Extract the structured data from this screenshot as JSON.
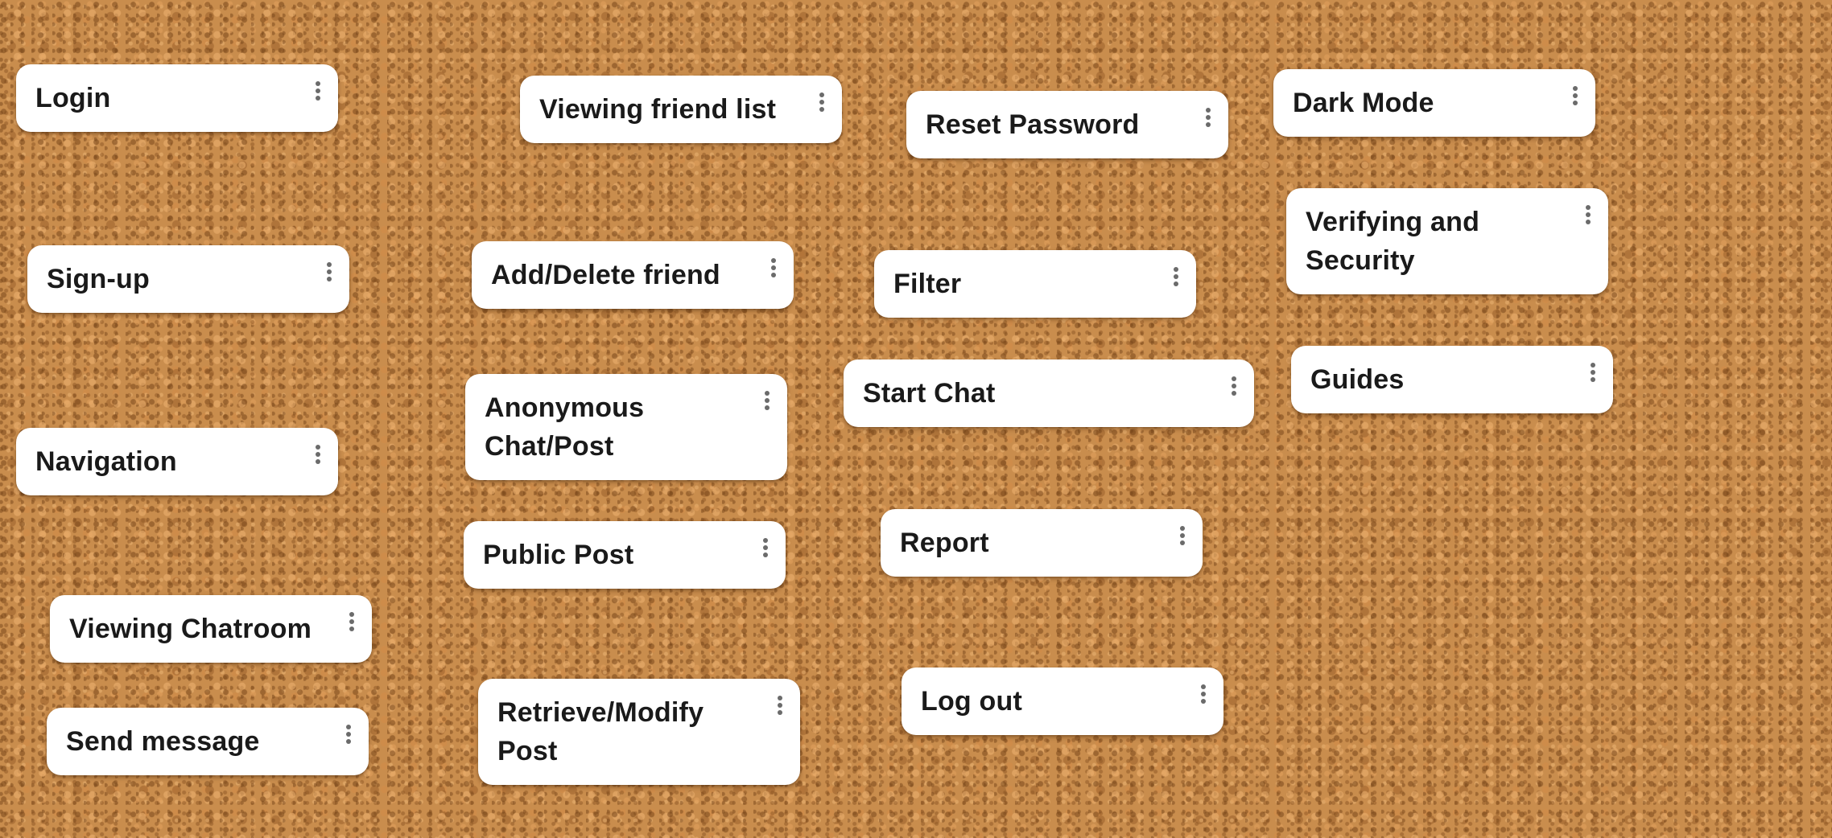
{
  "board": {
    "cards": [
      {
        "id": "login",
        "title": "Login"
      },
      {
        "id": "signup",
        "title": "Sign-up"
      },
      {
        "id": "navigation",
        "title": "Navigation"
      },
      {
        "id": "view_chatroom",
        "title": "Viewing Chatroom"
      },
      {
        "id": "send_message",
        "title": "Send message"
      },
      {
        "id": "friend_list",
        "title": "Viewing friend list"
      },
      {
        "id": "add_friend",
        "title": "Add/Delete friend"
      },
      {
        "id": "anon",
        "title": "Anonymous Chat/Post"
      },
      {
        "id": "public_post",
        "title": "Public Post"
      },
      {
        "id": "retrieve",
        "title": "Retrieve/Modify Post"
      },
      {
        "id": "reset_pw",
        "title": "Reset Password"
      },
      {
        "id": "filter",
        "title": "Filter"
      },
      {
        "id": "start_chat",
        "title": "Start Chat"
      },
      {
        "id": "report",
        "title": "Report"
      },
      {
        "id": "logout",
        "title": "Log out"
      },
      {
        "id": "dark_mode",
        "title": "Dark Mode"
      },
      {
        "id": "verify",
        "title": "Verifying and Security"
      },
      {
        "id": "guides",
        "title": "Guides"
      }
    ],
    "menu_icon": "more-vertical-icon",
    "colors": {
      "card_background": "#ffffff",
      "card_text": "#1a1a1a",
      "board_cork": "#c98d4d",
      "menu_dots": "#6b6b6b"
    }
  }
}
